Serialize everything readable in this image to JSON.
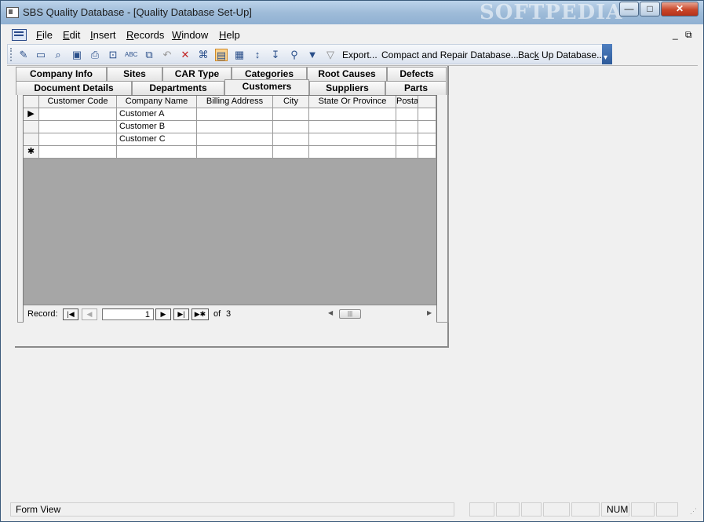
{
  "window": {
    "title": "SBS Quality Database - [Quality Database Set-Up]",
    "watermark": "SOFTPEDIA",
    "controls": {
      "minimize": "—",
      "maximize": "□",
      "close": "✕"
    }
  },
  "menubar": {
    "items": [
      {
        "key": "F",
        "rest": "ile"
      },
      {
        "key": "E",
        "rest": "dit"
      },
      {
        "key": "I",
        "rest": "nsert"
      },
      {
        "key": "R",
        "rest": "ecords"
      },
      {
        "key": "W",
        "rest": "indow"
      },
      {
        "key": "H",
        "rest": "elp"
      }
    ],
    "mdi_minimize": "_",
    "mdi_restore": "⧉"
  },
  "toolbar": {
    "export": "Export...",
    "compact": "Compact and Repair Database...",
    "backup_pre": "Bac",
    "backup_key": "k",
    "backup_rest": " Up Database..."
  },
  "tabs": {
    "row1": [
      "Company Info",
      "Sites",
      "CAR Type",
      "Categories",
      "Root Causes",
      "Defects"
    ],
    "row2": [
      "Document Details",
      "Departments",
      "Customers",
      "Suppliers",
      "Parts"
    ],
    "active": "Customers"
  },
  "grid": {
    "columns": [
      "Customer Code",
      "Company Name",
      "Billing Address",
      "City",
      "State Or Province",
      "Posta"
    ],
    "rows": [
      {
        "selector": "▶",
        "cells": [
          "",
          "Customer A",
          "",
          "",
          "",
          "",
          ""
        ]
      },
      {
        "selector": "",
        "cells": [
          "",
          "Customer B",
          "",
          "",
          "",
          "",
          ""
        ]
      },
      {
        "selector": "",
        "cells": [
          "",
          "Customer C",
          "",
          "",
          "",
          "",
          ""
        ]
      },
      {
        "selector": "✱",
        "cells": [
          "",
          "",
          "",
          "",
          "",
          "",
          ""
        ]
      }
    ]
  },
  "navigation": {
    "record_label": "Record:",
    "current": "1",
    "of_label": "of",
    "total": "3",
    "first": "|◀",
    "prev": "◀",
    "next": "▶",
    "last": "▶|",
    "new": "▶✱"
  },
  "statusbar": {
    "mode": "Form View",
    "num": "NUM"
  }
}
